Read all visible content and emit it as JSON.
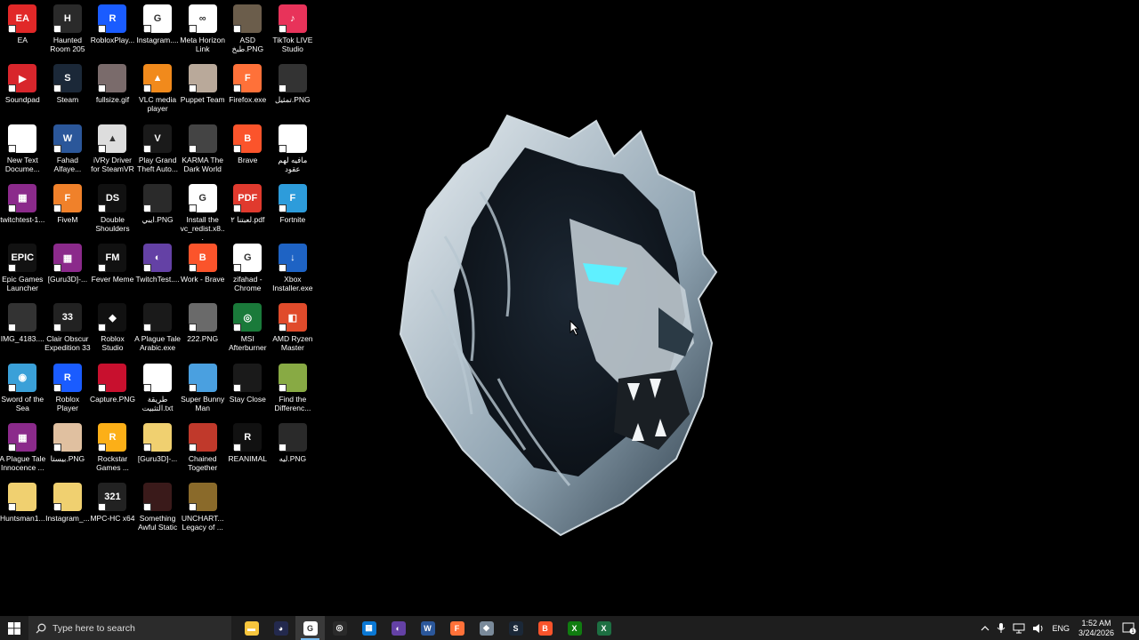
{
  "desktop": {
    "icons": [
      {
        "label": "EA",
        "color": "#e12828",
        "glyph": "EA"
      },
      {
        "label": "Haunted Room 205",
        "color": "#2a2a2a",
        "glyph": "H"
      },
      {
        "label": "RobloxPlay...",
        "color": "#1a5cff",
        "glyph": "R"
      },
      {
        "label": "Instagram....",
        "color": "#ffffff",
        "glyph": "G"
      },
      {
        "label": "Meta Horizon Link",
        "color": "#ffffff",
        "glyph": "∞"
      },
      {
        "label": "ASD طبخ.PNG",
        "color": "#6b5d4b",
        "glyph": ""
      },
      {
        "label": "TikTok LIVE Studio",
        "color": "#e8335a",
        "glyph": "♪"
      },
      {
        "label": "Soundpad",
        "color": "#d8262c",
        "glyph": "▶"
      },
      {
        "label": "Steam",
        "color": "#1b2838",
        "glyph": "S"
      },
      {
        "label": "fullsize.gif",
        "color": "#7a6b6b",
        "glyph": ""
      },
      {
        "label": "VLC media player",
        "color": "#f18a1c",
        "glyph": "▲"
      },
      {
        "label": "Puppet Team",
        "color": "#b9a99a",
        "glyph": ""
      },
      {
        "label": "Firefox.exe",
        "color": "#ff7139",
        "glyph": "F"
      },
      {
        "label": "تمثيل.PNG",
        "color": "#333333",
        "glyph": ""
      },
      {
        "label": "New Text Docume...",
        "color": "#ffffff",
        "glyph": ""
      },
      {
        "label": "Fahad Alfaye...",
        "color": "#2b579a",
        "glyph": "W"
      },
      {
        "label": "iVRy Driver for SteamVR",
        "color": "#dddddd",
        "glyph": "▲"
      },
      {
        "label": "Play Grand Theft Auto...",
        "color": "#1a1a1a",
        "glyph": "V"
      },
      {
        "label": "KARMA The Dark World",
        "color": "#444444",
        "glyph": ""
      },
      {
        "label": "Brave",
        "color": "#fb542b",
        "glyph": "B"
      },
      {
        "label": "مافيه لهم عقود",
        "color": "#ffffff",
        "glyph": ""
      },
      {
        "label": "twitchtest-1...",
        "color": "#8b2a8b",
        "glyph": "▦"
      },
      {
        "label": "FiveM",
        "color": "#f0812a",
        "glyph": "F"
      },
      {
        "label": "Double Shoulders",
        "color": "#111111",
        "glyph": "DS"
      },
      {
        "label": "ايبي.PNG",
        "color": "#2a2a2a",
        "glyph": ""
      },
      {
        "label": "Install the vc_redist.x8...",
        "color": "#ffffff",
        "glyph": "G"
      },
      {
        "label": "لعبتنا ٢.pdf",
        "color": "#e03a2e",
        "glyph": "PDF"
      },
      {
        "label": "Fortnite",
        "color": "#2d9cdb",
        "glyph": "F"
      },
      {
        "label": "Epic Games Launcher",
        "color": "#121212",
        "glyph": "EPIC"
      },
      {
        "label": "[Guru3D]-...",
        "color": "#8b2a8b",
        "glyph": "▦"
      },
      {
        "label": "Fever Meme",
        "color": "#111111",
        "glyph": "FM"
      },
      {
        "label": "TwitchTest....",
        "color": "#6441a5",
        "glyph": "◐"
      },
      {
        "label": "Work - Brave",
        "color": "#fb542b",
        "glyph": "B"
      },
      {
        "label": "zifahad - Chrome",
        "color": "#ffffff",
        "glyph": "G"
      },
      {
        "label": "Xbox Installer.exe",
        "color": "#1e63c4",
        "glyph": "↓"
      },
      {
        "label": "IMG_4183....",
        "color": "#333333",
        "glyph": ""
      },
      {
        "label": "Clair Obscur Expedition 33",
        "color": "#222222",
        "glyph": "33"
      },
      {
        "label": "Roblox Studio",
        "color": "#111111",
        "glyph": "◆"
      },
      {
        "label": "A Plague Tale Arabic.exe",
        "color": "#1a1a1a",
        "glyph": ""
      },
      {
        "label": "222.PNG",
        "color": "#6a6a6a",
        "glyph": ""
      },
      {
        "label": "MSI Afterburner",
        "color": "#1a7a3a",
        "glyph": "◎"
      },
      {
        "label": "AMD Ryzen Master",
        "color": "#e04b2b",
        "glyph": "◧"
      },
      {
        "label": "Sword of the Sea",
        "color": "#3aa0d8",
        "glyph": "◉"
      },
      {
        "label": "Roblox Player",
        "color": "#1a5cff",
        "glyph": "R"
      },
      {
        "label": "Capture.PNG",
        "color": "#c8102e",
        "glyph": ""
      },
      {
        "label": "طريقة التثبيت.txt",
        "color": "#ffffff",
        "glyph": ""
      },
      {
        "label": "Super Bunny Man",
        "color": "#4aa0e0",
        "glyph": ""
      },
      {
        "label": "Stay Close",
        "color": "#1a1a1a",
        "glyph": ""
      },
      {
        "label": "Find the Differenc...",
        "color": "#88aa44",
        "glyph": ""
      },
      {
        "label": "A Plague Tale Innocence ...",
        "color": "#8b2a8b",
        "glyph": "▦"
      },
      {
        "label": "بيستا.PNG",
        "color": "#e0c0a0",
        "glyph": ""
      },
      {
        "label": "Rockstar Games ...",
        "color": "#fcaf17",
        "glyph": "R"
      },
      {
        "label": "[Guru3D]-...",
        "color": "#f0d070",
        "glyph": ""
      },
      {
        "label": "Chained Together",
        "color": "#c0392b",
        "glyph": ""
      },
      {
        "label": "REANIMAL",
        "color": "#111111",
        "glyph": "R"
      },
      {
        "label": "ليه.PNG",
        "color": "#2a2a2a",
        "glyph": ""
      },
      {
        "label": "Huntsman1...",
        "color": "#f0d070",
        "glyph": ""
      },
      {
        "label": "Instagram_...",
        "color": "#f0d070",
        "glyph": ""
      },
      {
        "label": "MPC-HC x64",
        "color": "#222222",
        "glyph": "321"
      },
      {
        "label": "Something Awful Static",
        "color": "#3a1a1a",
        "glyph": ""
      },
      {
        "label": "UNCHART... Legacy of ...",
        "color": "#8a6a2a",
        "glyph": ""
      }
    ]
  },
  "taskbar": {
    "search_placeholder": "Type here to search",
    "apps": [
      {
        "name": "file-explorer-icon",
        "color": "#f8c63d",
        "glyph": "▬",
        "running": false,
        "active": false
      },
      {
        "name": "discord-icon",
        "color": "#23294d",
        "glyph": "◕",
        "running": false,
        "active": false
      },
      {
        "name": "chrome-icon",
        "color": "#ffffff",
        "glyph": "G",
        "running": true,
        "active": true
      },
      {
        "name": "steamvr-icon",
        "color": "#2a2a2a",
        "glyph": "◎",
        "running": false,
        "active": false
      },
      {
        "name": "microsoft-store-icon",
        "color": "#0a78d4",
        "glyph": "▦",
        "running": false,
        "active": false
      },
      {
        "name": "twitch-test-icon",
        "color": "#6441a5",
        "glyph": "◐",
        "running": false,
        "active": false
      },
      {
        "name": "word-icon",
        "color": "#2b579a",
        "glyph": "W",
        "running": false,
        "active": false
      },
      {
        "name": "firefox-icon",
        "color": "#ff7139",
        "glyph": "F",
        "running": false,
        "active": false
      },
      {
        "name": "figure-icon",
        "color": "#7a8a9a",
        "glyph": "◆",
        "running": false,
        "active": false
      },
      {
        "name": "steam-icon",
        "color": "#1b2838",
        "glyph": "S",
        "running": false,
        "active": false
      },
      {
        "name": "brave-icon",
        "color": "#fb542b",
        "glyph": "B",
        "running": false,
        "active": false
      },
      {
        "name": "xbox-icon",
        "color": "#107c10",
        "glyph": "X",
        "running": false,
        "active": false
      },
      {
        "name": "excel-icon",
        "color": "#1d6f42",
        "glyph": "X",
        "running": false,
        "active": false
      }
    ],
    "tray": {
      "language": "ENG",
      "time": "1:52 AM",
      "date": "3/24/2026",
      "notification_count": "1"
    }
  }
}
